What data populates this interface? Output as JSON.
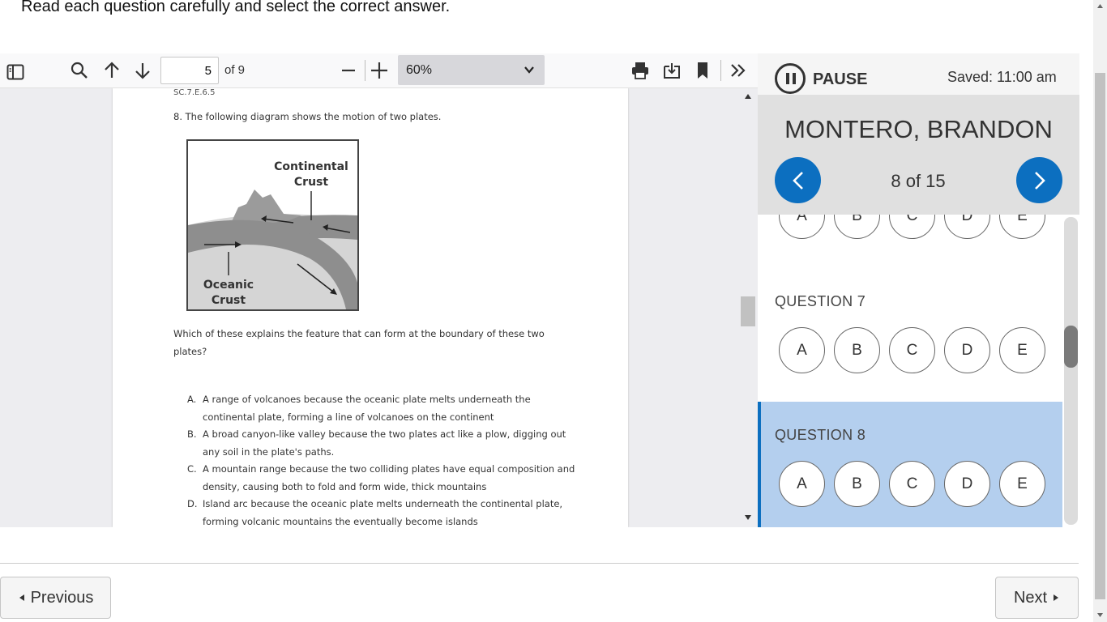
{
  "instructions": "Read each question carefully and select the correct answer.",
  "pdf": {
    "page_value": "5",
    "page_total": "of 9",
    "zoom": "60%",
    "standard_code": "SC.7.E.6.5",
    "question_stem": "8.  The following diagram shows the motion of two plates.",
    "diagram": {
      "label_top": [
        "Continental",
        "Crust"
      ],
      "label_bottom": [
        "Oceanic",
        "Crust"
      ]
    },
    "question_prompt": "Which of these explains the feature that can form at the boundary of these two plates?",
    "choices": [
      {
        "letter": "A.",
        "text": "A range of volcanoes because the oceanic plate melts underneath the continental plate, forming a line of volcanoes on the continent"
      },
      {
        "letter": "B.",
        "text": "A broad canyon-like valley because the two plates act like a plow, digging out any soil in the plate's paths."
      },
      {
        "letter": "C.",
        "text": "A mountain range because the two colliding plates have equal composition and density, causing both to fold and form wide, thick mountains"
      },
      {
        "letter": "D.",
        "text": "Island arc because the oceanic plate melts underneath the continental plate, forming volcanic mountains the eventually become islands"
      }
    ]
  },
  "panel": {
    "pause_label": "PAUSE",
    "saved": "Saved: 11:00 am",
    "student_name": "MONTERO, BRANDON",
    "counter": "8 of 15",
    "options": [
      "A",
      "B",
      "C",
      "D",
      "E"
    ],
    "q7_label": "QUESTION 7",
    "q8_label": "QUESTION 8"
  },
  "footer": {
    "previous": "Previous",
    "next": "Next"
  },
  "colors": {
    "accent": "#0c6fc0",
    "selected_bg": "#b4cfee"
  }
}
